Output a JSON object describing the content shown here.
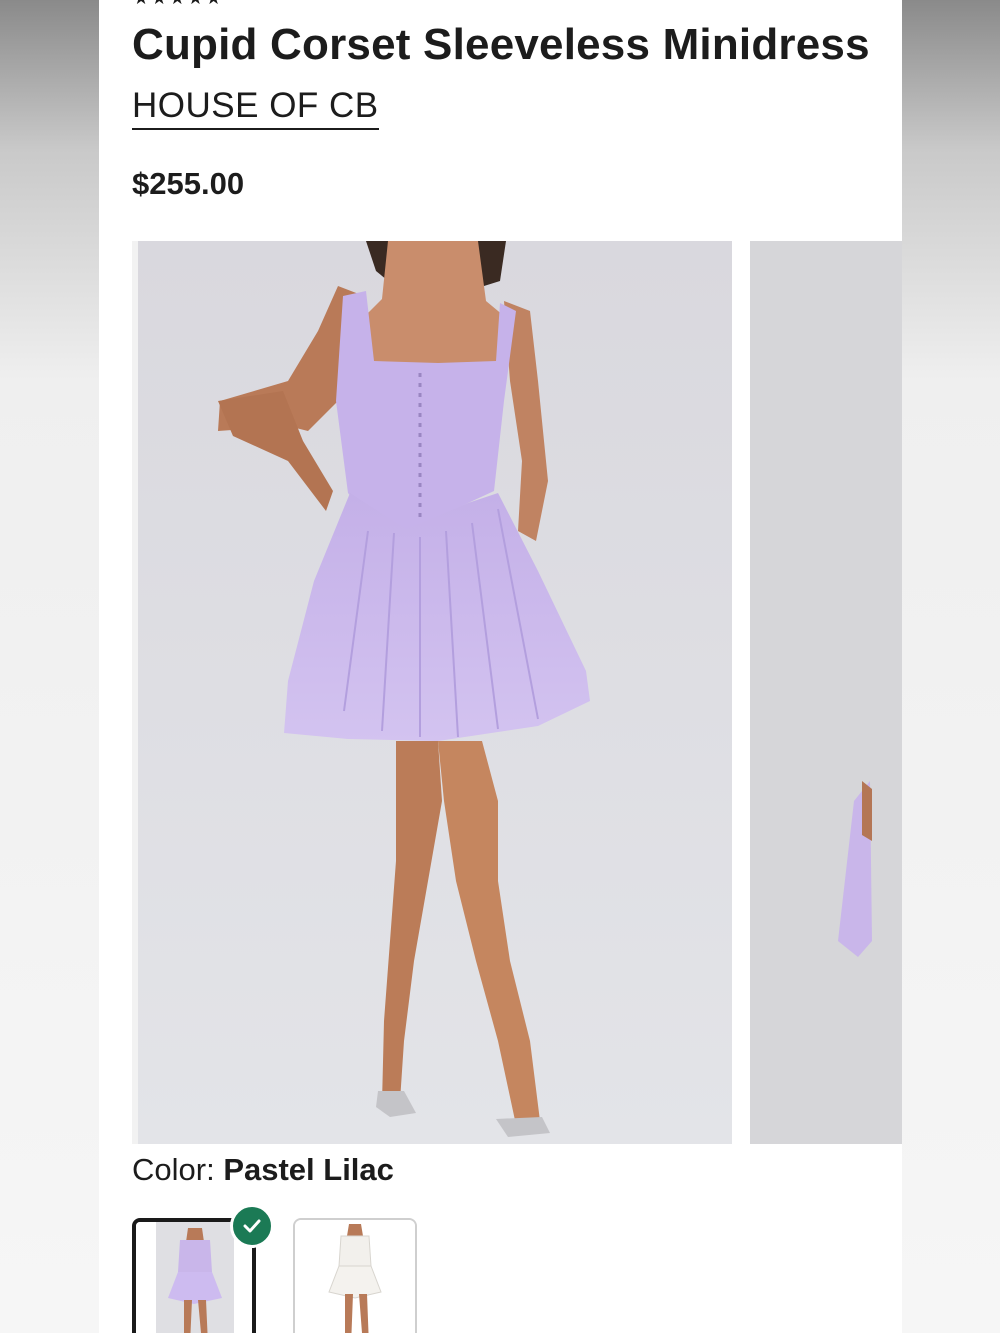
{
  "product": {
    "rating_stars": "★★★★★",
    "title": "Cupid Corset Sleeveless Minidress",
    "brand": "HOUSE OF CB",
    "price": "$255.00"
  },
  "gallery": {
    "images": [
      {
        "icon": "model-wearing-lilac-dress-image"
      },
      {
        "icon": "next-image-peek"
      }
    ]
  },
  "color_selector": {
    "label": "Color: ",
    "selected_value": "Pastel Lilac",
    "swatches": [
      {
        "name": "Pastel Lilac",
        "selected": true,
        "color": "#c9b6ea"
      },
      {
        "name": "White",
        "selected": false,
        "color": "#f2f0ec"
      }
    ],
    "selected_badge_color": "#1b7a55"
  }
}
